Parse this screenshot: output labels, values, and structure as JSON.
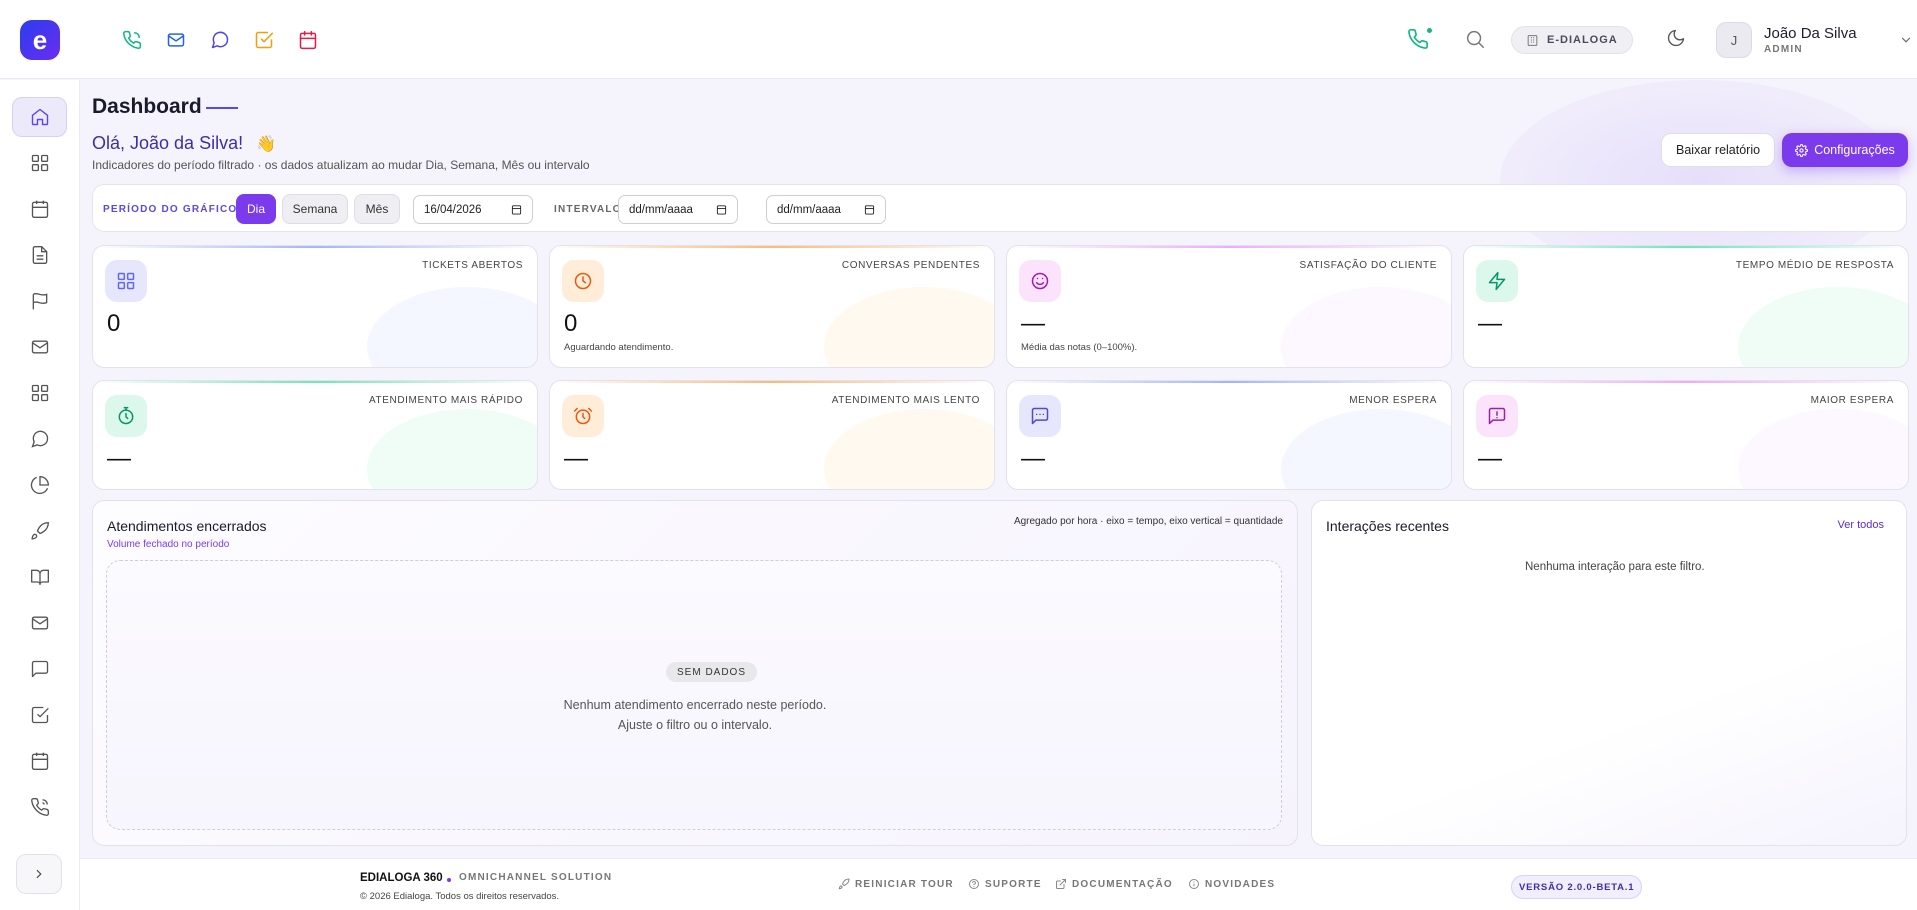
{
  "topbar": {
    "logo_letter": "e",
    "company": "E-DIALOGA",
    "user": {
      "initial": "J",
      "name": "João Da Silva",
      "role": "ADMIN"
    }
  },
  "sidebar": {
    "items": [
      {
        "icon": "home-icon",
        "active": true
      },
      {
        "icon": "grid-icon"
      },
      {
        "icon": "calendar-icon"
      },
      {
        "icon": "document-icon"
      },
      {
        "icon": "flag-icon"
      },
      {
        "icon": "mail-icon"
      },
      {
        "icon": "apps-icon"
      },
      {
        "icon": "chat-bubble-icon"
      },
      {
        "icon": "pie-chart-icon"
      },
      {
        "icon": "rocket-icon"
      },
      {
        "icon": "book-icon"
      },
      {
        "icon": "mail-icon"
      },
      {
        "icon": "message-square-icon"
      },
      {
        "icon": "check-square-icon"
      },
      {
        "icon": "calendar-icon"
      },
      {
        "icon": "phone-icon"
      }
    ]
  },
  "header": {
    "title": "Dashboard",
    "greeting": "Olá, João da Silva!",
    "greeting_emoji": "👋",
    "subtitle": "Indicadores do período filtrado · os dados atualizam ao mudar Dia, Semana, Mês ou intervalo",
    "report_button": "Baixar relatório",
    "config_button": "Configurações"
  },
  "filters": {
    "period_label": "PERÍODO DO GRÁFICO",
    "period_options": [
      "Dia",
      "Semana",
      "Mês"
    ],
    "selected_period": "Dia",
    "date_value": "16/04/2026",
    "interval_label": "INTERVALO",
    "interval_start_placeholder": "dd/mm/aaaa",
    "interval_end_placeholder": "dd/mm/aaaa"
  },
  "kpis": [
    {
      "label": "TICKETS ABERTOS",
      "value": "0",
      "note": "",
      "icon": "grid-icon",
      "color": "#6366f1"
    },
    {
      "label": "CONVERSAS PENDENTES",
      "value": "0",
      "note": "Aguardando atendimento.",
      "icon": "clock-icon",
      "color": "#ea580c"
    },
    {
      "label": "SATISFAÇÃO DO CLIENTE",
      "value": "—",
      "note": "Média das notas (0–100%).",
      "icon": "smile-icon",
      "color": "#a21caf"
    },
    {
      "label": "TEMPO MÉDIO DE RESPOSTA",
      "value": "—",
      "note": "",
      "icon": "zap-icon",
      "color": "#059669"
    },
    {
      "label": "ATENDIMENTO MAIS RÁPIDO",
      "value": "—",
      "note": "",
      "icon": "timer-icon",
      "color": "#059669"
    },
    {
      "label": "ATENDIMENTO MAIS LENTO",
      "value": "—",
      "note": "",
      "icon": "alarm-clock-icon",
      "color": "#ea580c"
    },
    {
      "label": "MENOR ESPERA",
      "value": "—",
      "note": "",
      "icon": "message-dots-icon",
      "color": "#4f46e5"
    },
    {
      "label": "MAIOR ESPERA",
      "value": "—",
      "note": "",
      "icon": "message-alert-icon",
      "color": "#a21caf"
    }
  ],
  "closed_chart": {
    "title": "Atendimentos encerrados",
    "subtitle": "Volume fechado no período",
    "hint": "Agregado por hora · eixo = tempo, eixo vertical = quantidade",
    "empty_badge": "SEM DADOS",
    "empty_text": "Nenhum atendimento encerrado neste período. Ajuste o filtro ou o intervalo."
  },
  "recent": {
    "title": "Interações recentes",
    "see_all": "Ver todos",
    "empty": "Nenhuma interação para este filtro."
  },
  "footer": {
    "brand": "EDIALOGA 360",
    "tagline": "OMNICHANNEL SOLUTION",
    "copyright": "© 2026 Edialoga. Todos os direitos reservados.",
    "links": [
      "REINICIAR TOUR",
      "SUPORTE",
      "DOCUMENTAÇÃO",
      "NOVIDADES"
    ],
    "version": "VERSÃO 2.0.0-BETA.1"
  },
  "colors": {
    "accent": "#7c3aed",
    "accent_dark": "#3e2ea8",
    "background": "#f5f3fb"
  }
}
